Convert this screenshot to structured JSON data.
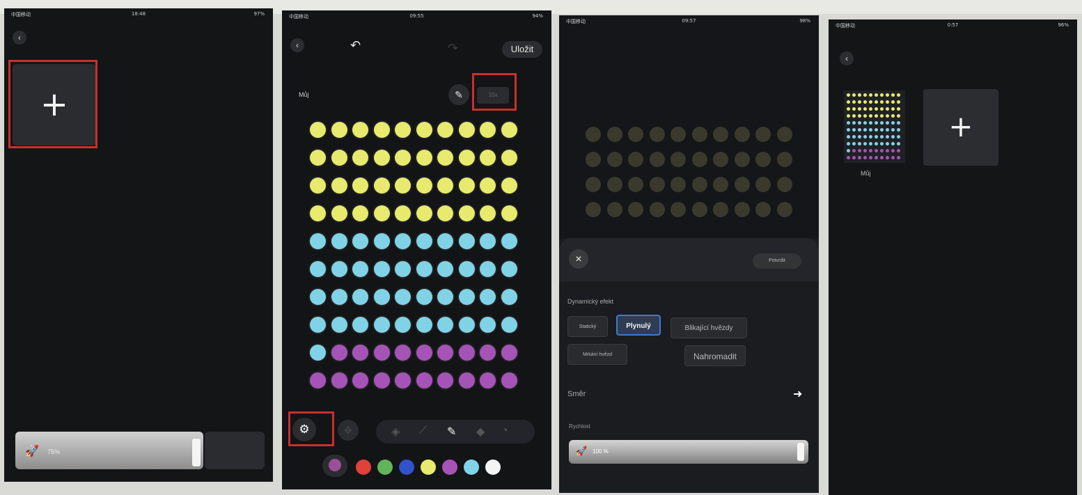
{
  "status": {
    "p1": {
      "carrier": "中国移动",
      "time": "18:48",
      "battery": "97%"
    },
    "p2": {
      "carrier": "中国移动",
      "time": "09:55",
      "battery": "94%"
    },
    "p3": {
      "carrier": "中国移动",
      "time": "09:57",
      "battery": "98%"
    },
    "p4": {
      "carrier": "中国移动",
      "time": "0:57",
      "battery": "96%"
    }
  },
  "panel1": {
    "add_tile_icon": "+",
    "slider_value": "75%",
    "slider_icon": "rocket-icon"
  },
  "panel2": {
    "save_label": "Uložit",
    "name_label": "Můj",
    "size_button_label": "10x",
    "grid_rows": [
      "yellow",
      "yellow",
      "yellow",
      "yellow",
      "cyan",
      "cyan",
      "cyan",
      "cyan",
      "mixed",
      "purple"
    ],
    "colors": {
      "yellow": "#e7ea6d",
      "cyan": "#80d3e6",
      "purple": "#a653b8",
      "red": "#e0413b",
      "green": "#63b35a",
      "blue": "#3152c8",
      "white": "#f4f4f4"
    },
    "palette": [
      "#e0413b",
      "#63b35a",
      "#3152c8",
      "#e7ea6d",
      "#a653b8",
      "#80d3e6",
      "#f4f4f4"
    ],
    "tools": [
      "fill-icon",
      "magic-wand-icon",
      "pencil-icon",
      "eraser-icon",
      "eyedropper-icon",
      "more-icon"
    ]
  },
  "panel3": {
    "confirm_label": "Potvrdit",
    "section_title": "Dynamický efekt",
    "effects": [
      "Statický",
      "Plynulý",
      "Blikající hvězdy",
      "Mrkání hvězd",
      "Nahromadit"
    ],
    "selected_effect": "Plynulý",
    "direction_label": "Směr",
    "speed_label": "Rychlost",
    "slider_value": "100 %"
  },
  "panel4": {
    "saved_name": "Můj",
    "add_tile_icon": "+"
  }
}
